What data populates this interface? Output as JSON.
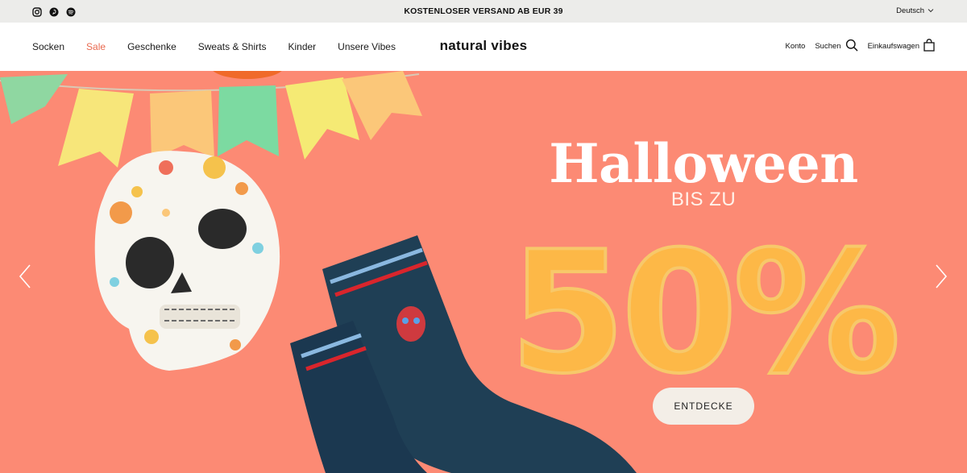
{
  "announcement": {
    "text": "KOSTENLOSER VERSAND AB EUR 39",
    "social_icons": [
      "instagram-icon",
      "pinterest-icon",
      "spotify-icon"
    ],
    "language": "Deutsch"
  },
  "header": {
    "logo": "natural vibes",
    "nav": [
      {
        "label": "Socken"
      },
      {
        "label": "Sale",
        "color": "#e9694f"
      },
      {
        "label": "Geschenke"
      },
      {
        "label": "Sweats & Shirts"
      },
      {
        "label": "Kinder"
      },
      {
        "label": "Unsere Vibes"
      }
    ],
    "account": "Konto",
    "search": "Suchen",
    "cart": "Einkaufswagen"
  },
  "hero": {
    "title": "Halloween",
    "subtitle": "BIS ZU",
    "discount": "50%",
    "cta": "ENTDECKE",
    "background_color": "#fc8a74"
  }
}
